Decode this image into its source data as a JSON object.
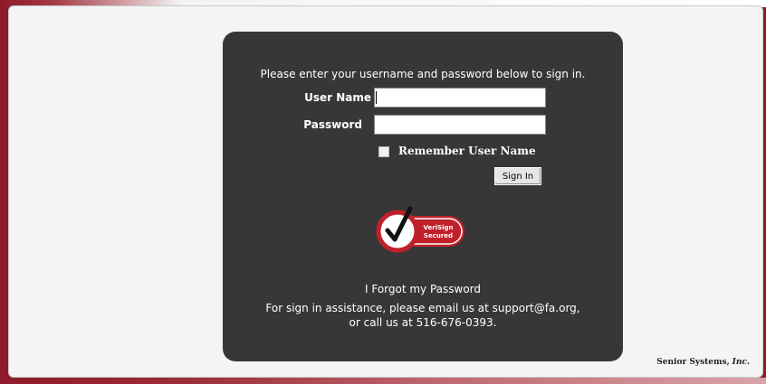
{
  "login": {
    "instructions": "Please enter your username and password below to sign in.",
    "username_label": "User Name",
    "username_value": "",
    "password_label": "Password",
    "password_value": "",
    "remember_label": "Remember User Name",
    "remember_checked": false,
    "signin_label": "Sign In"
  },
  "seal": {
    "icon": "verisign-secured-seal-icon",
    "line1": "VeriSign",
    "line2": "Secured"
  },
  "links": {
    "forgot_password": "I Forgot my Password"
  },
  "help": {
    "line1": "For sign in assistance, please email us at support@fa.org,",
    "line2": "or call us at 516-676-0393."
  },
  "footer": {
    "company": "Senior Systems,",
    "suffix": "Inc."
  },
  "colors": {
    "panel": "#373737",
    "frame": "#8e1a2a",
    "seal_red": "#c0202a"
  }
}
